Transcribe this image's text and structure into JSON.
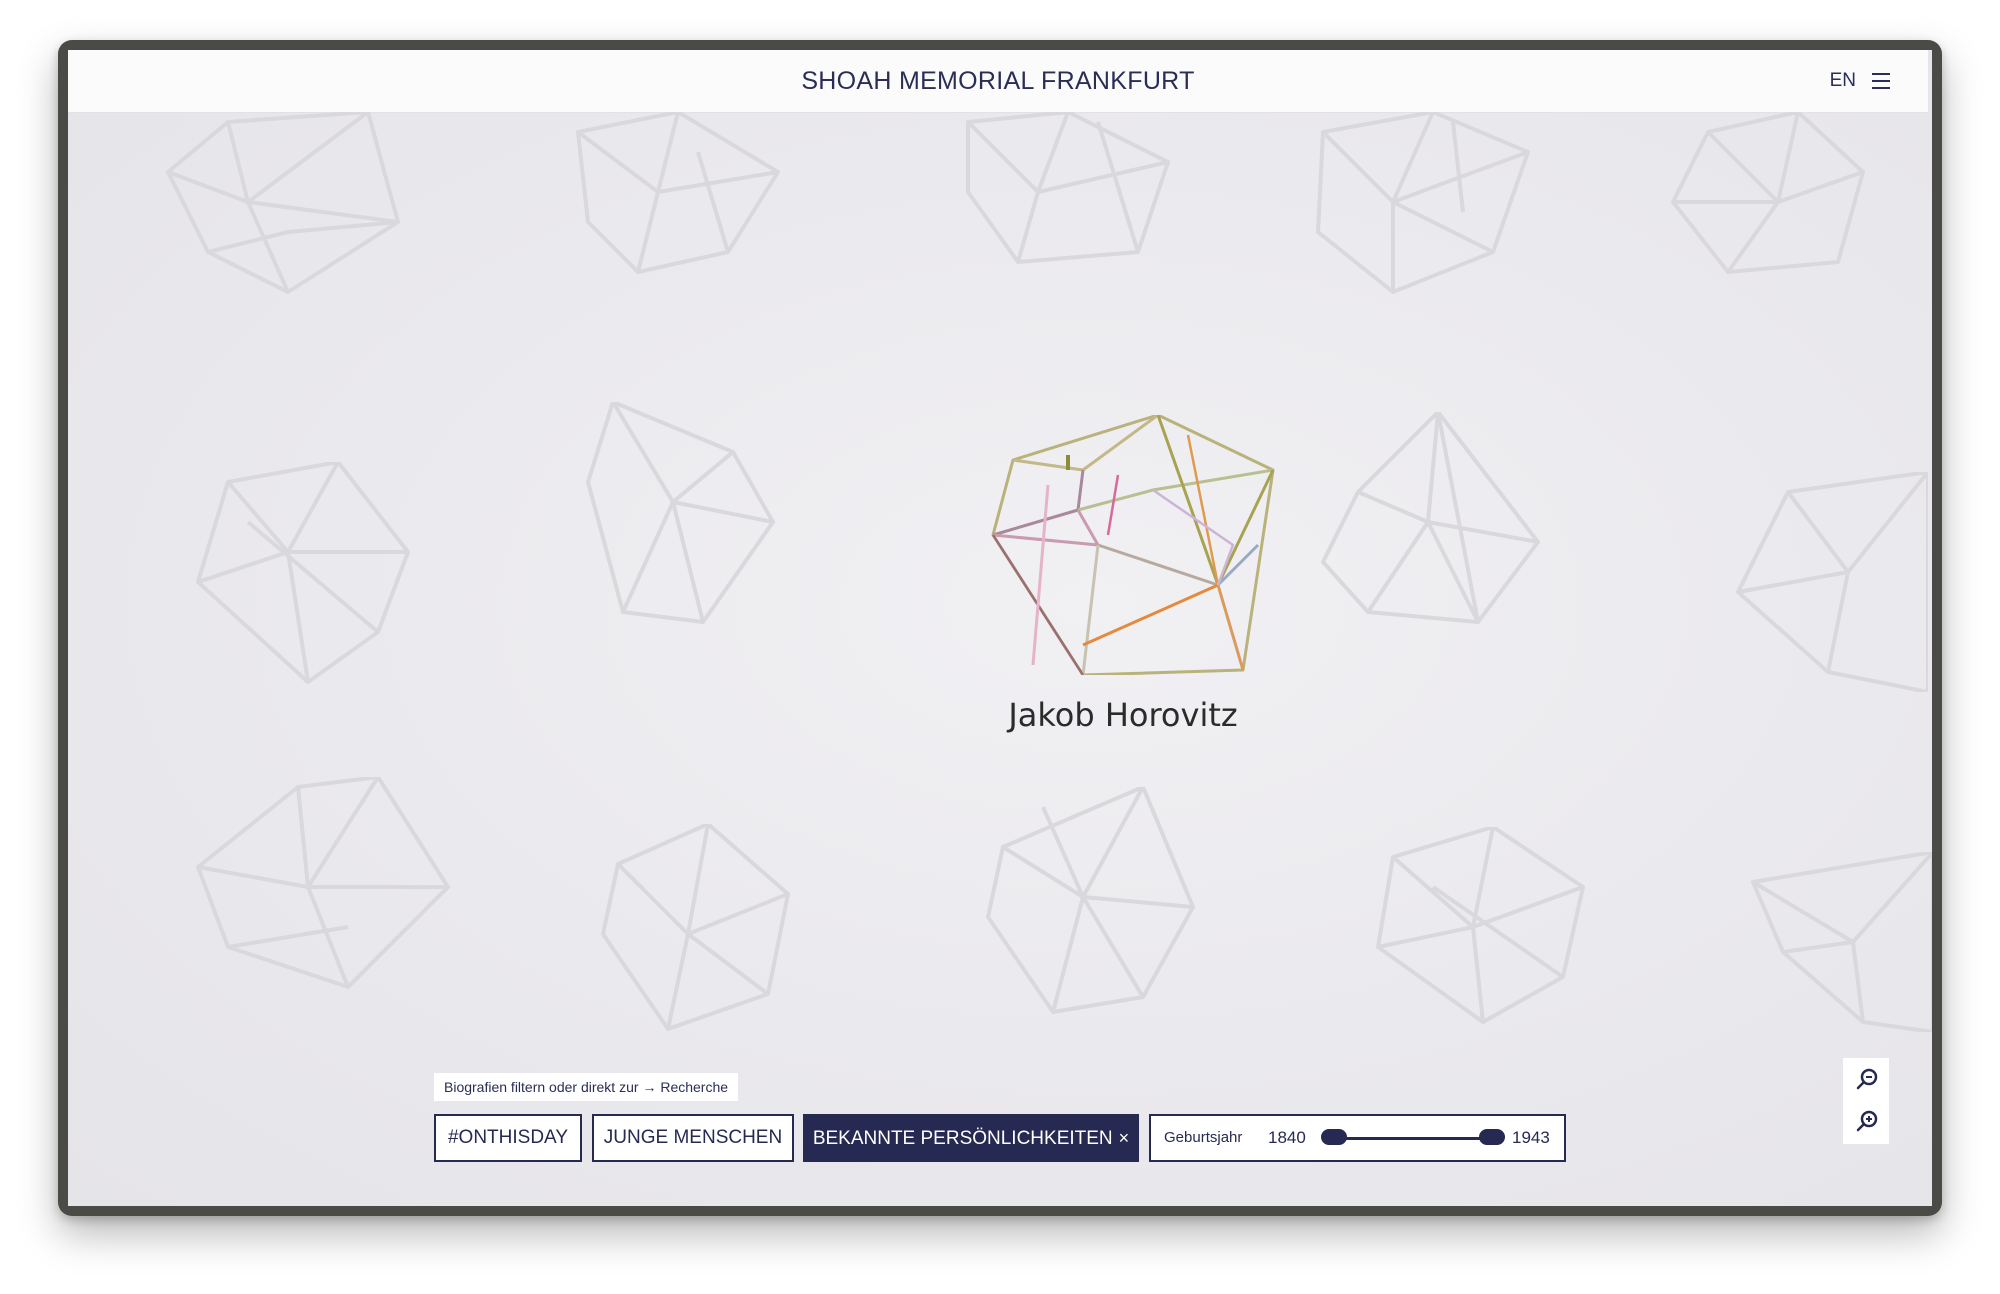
{
  "header": {
    "title": "SHOAH MEMORIAL FRANKFURT",
    "language": "EN",
    "menu_icon": "hamburger-menu-icon"
  },
  "focus": {
    "name": "Jakob Horovitz"
  },
  "filter": {
    "hint_prefix": "Biografien filtern oder direkt zur",
    "hint_arrow": "→",
    "hint_link": "Recherche",
    "chips": [
      {
        "label": "#ONTHISDAY",
        "active": false
      },
      {
        "label": "JUNGE MENSCHEN",
        "active": false
      },
      {
        "label": "BEKANNTE PERSÖNLICHKEITEN",
        "active": true
      }
    ],
    "active_close": "×",
    "range": {
      "label": "Geburtsjahr",
      "min": "1840",
      "max": "1943"
    }
  },
  "zoom": {
    "zoom_out_icon": "zoom-out-icon",
    "zoom_in_icon": "zoom-in-icon"
  },
  "colors": {
    "navy": "#262a52",
    "background": "#ebeaee",
    "crystal_outline": "#d9d8dc"
  }
}
